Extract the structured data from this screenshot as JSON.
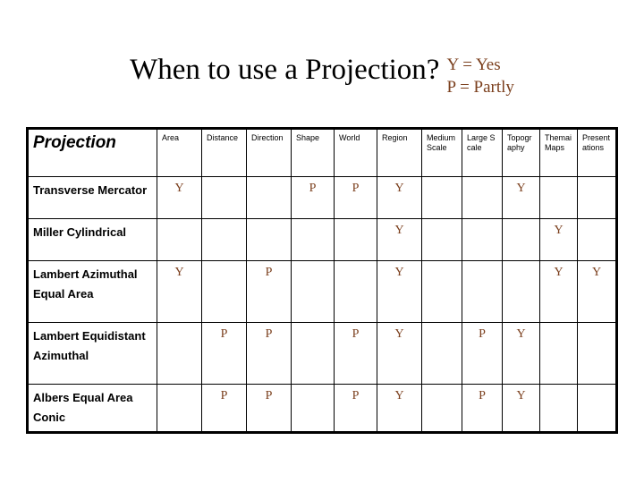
{
  "slide": {
    "title": "When to use a Projection?",
    "legend": {
      "yes": "Y = Yes",
      "partly": "P = Partly",
      "color": "#7B3F1D"
    }
  },
  "table": {
    "corner_header": "Projection",
    "columns": [
      "Area",
      "Distance",
      "Direction",
      "Shape",
      "World",
      "Region",
      "Medium Scale",
      "Large Scale",
      "Topography",
      "Themai Maps",
      "Presentations"
    ],
    "rows": [
      {
        "label": "Transverse Mercator",
        "values": [
          "Y",
          "",
          "",
          "P",
          "P",
          "Y",
          "",
          "",
          "Y",
          "",
          ""
        ]
      },
      {
        "label": "Miller Cylindrical",
        "values": [
          "",
          "",
          "",
          "",
          "",
          "Y",
          "",
          "",
          "",
          "Y",
          ""
        ]
      },
      {
        "label": "Lambert Azimuthal Equal Area",
        "values": [
          "Y",
          "",
          "P",
          "",
          "",
          "Y",
          "",
          "",
          "",
          "Y",
          "Y"
        ]
      },
      {
        "label": "Lambert Equidistant Azimuthal",
        "values": [
          "",
          "P",
          "P",
          "",
          "P",
          "Y",
          "",
          "P",
          "Y",
          "",
          ""
        ]
      },
      {
        "label": "Albers Equal Area Conic",
        "values": [
          "",
          "P",
          "P",
          "",
          "P",
          "Y",
          "",
          "P",
          "Y",
          "",
          ""
        ]
      }
    ]
  }
}
